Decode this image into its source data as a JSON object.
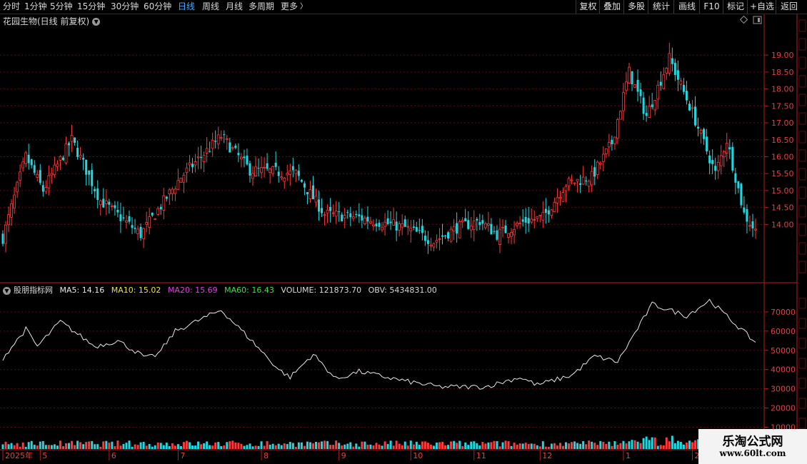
{
  "toolbar": {
    "tabs": [
      {
        "label": "分时"
      },
      {
        "label": "1分钟"
      },
      {
        "label": "5分钟"
      },
      {
        "label": "15分钟"
      },
      {
        "label": "30分钟"
      },
      {
        "label": "60分钟"
      },
      {
        "label": "日线"
      },
      {
        "label": "周线"
      },
      {
        "label": "月线"
      },
      {
        "label": "多周期"
      },
      {
        "label": "更多"
      }
    ],
    "active_tab": "日线",
    "right_buttons": [
      {
        "label": "复权"
      },
      {
        "label": "叠加"
      },
      {
        "label": "多股"
      },
      {
        "label": "统计"
      },
      {
        "label": "画线"
      },
      {
        "label": "F10"
      },
      {
        "label": "标记"
      },
      {
        "label": "+自选"
      },
      {
        "label": "返回"
      }
    ]
  },
  "stock": {
    "title": "花园生物(日线 前复权)"
  },
  "indicator": {
    "name": "股朋指标网",
    "ma5": "MA5: 14.16",
    "ma10": "MA10: 15.02",
    "ma20": "MA20: 15.69",
    "ma60": "MA60: 16.43",
    "volume": "VOLUME: 121873.70",
    "obv": "OBV: 5434831.00"
  },
  "colors": {
    "up": "#ff3a3a",
    "down": "#22d8e0",
    "axis": "#e84040",
    "ma5": "#e8e8e8",
    "ma10": "#f0e040",
    "ma20": "#e040e0",
    "ma60": "#40e040",
    "obv_line": "#e8e8e8"
  },
  "chart_data": [
    {
      "type": "candlestick",
      "y_ticks": [
        14.0,
        14.5,
        15.0,
        15.5,
        16.0,
        16.5,
        17.0,
        17.5,
        18.0,
        18.5,
        19.0
      ],
      "ylim": [
        12.7,
        19.7
      ],
      "anchors": [
        {
          "i": 0,
          "c": 13.6
        },
        {
          "i": 8,
          "c": 16.0
        },
        {
          "i": 14,
          "c": 15.0
        },
        {
          "i": 24,
          "c": 16.5
        },
        {
          "i": 34,
          "c": 14.7
        },
        {
          "i": 48,
          "c": 13.7
        },
        {
          "i": 62,
          "c": 15.4
        },
        {
          "i": 76,
          "c": 16.6
        },
        {
          "i": 86,
          "c": 15.6
        },
        {
          "i": 102,
          "c": 15.5
        },
        {
          "i": 112,
          "c": 14.3
        },
        {
          "i": 124,
          "c": 14.2
        },
        {
          "i": 140,
          "c": 13.9
        },
        {
          "i": 150,
          "c": 13.5
        },
        {
          "i": 158,
          "c": 13.9
        },
        {
          "i": 166,
          "c": 14.1
        },
        {
          "i": 172,
          "c": 13.7
        },
        {
          "i": 182,
          "c": 14.1
        },
        {
          "i": 188,
          "c": 14.2
        },
        {
          "i": 196,
          "c": 15.2
        },
        {
          "i": 205,
          "c": 15.4
        },
        {
          "i": 212,
          "c": 16.4
        },
        {
          "i": 218,
          "c": 18.5
        },
        {
          "i": 224,
          "c": 17.2
        },
        {
          "i": 232,
          "c": 18.9
        },
        {
          "i": 240,
          "c": 17.3
        },
        {
          "i": 248,
          "c": 15.5
        },
        {
          "i": 252,
          "c": 16.5
        },
        {
          "i": 258,
          "c": 14.3
        },
        {
          "i": 262,
          "c": 13.8
        }
      ],
      "count": 263
    },
    {
      "type": "line",
      "series_name": "OBV",
      "y_ticks": [
        10000,
        20000,
        30000,
        40000,
        50000,
        60000,
        70000
      ],
      "ylim": [
        2000,
        80000
      ],
      "anchors": [
        {
          "i": 0,
          "v": 46000
        },
        {
          "i": 8,
          "v": 61000
        },
        {
          "i": 12,
          "v": 52000
        },
        {
          "i": 20,
          "v": 65000
        },
        {
          "i": 32,
          "v": 52000
        },
        {
          "i": 40,
          "v": 55000
        },
        {
          "i": 50,
          "v": 46000
        },
        {
          "i": 54,
          "v": 48000
        },
        {
          "i": 60,
          "v": 60000
        },
        {
          "i": 76,
          "v": 71000
        },
        {
          "i": 86,
          "v": 56000
        },
        {
          "i": 96,
          "v": 40000
        },
        {
          "i": 100,
          "v": 36000
        },
        {
          "i": 108,
          "v": 48000
        },
        {
          "i": 116,
          "v": 35000
        },
        {
          "i": 124,
          "v": 39000
        },
        {
          "i": 140,
          "v": 34000
        },
        {
          "i": 152,
          "v": 31000
        },
        {
          "i": 168,
          "v": 31000
        },
        {
          "i": 180,
          "v": 36000
        },
        {
          "i": 186,
          "v": 32000
        },
        {
          "i": 198,
          "v": 37000
        },
        {
          "i": 206,
          "v": 47000
        },
        {
          "i": 214,
          "v": 44000
        },
        {
          "i": 226,
          "v": 74000
        },
        {
          "i": 238,
          "v": 68000
        },
        {
          "i": 246,
          "v": 76000
        },
        {
          "i": 262,
          "v": 54000
        }
      ],
      "count": 263
    }
  ],
  "date_axis": [
    {
      "label": "2025年",
      "i": 0
    },
    {
      "label": "5",
      "i": 13
    },
    {
      "label": "6",
      "i": 37
    },
    {
      "label": "7",
      "i": 61
    },
    {
      "label": "8",
      "i": 90
    },
    {
      "label": "9",
      "i": 117
    },
    {
      "label": "10",
      "i": 142
    },
    {
      "label": "11",
      "i": 164
    },
    {
      "label": "12",
      "i": 187
    },
    {
      "label": "1",
      "i": 216
    },
    {
      "label": "2",
      "i": 240
    }
  ],
  "watermark": {
    "line1": "乐淘公式网",
    "line2": "www.60lt.com"
  }
}
